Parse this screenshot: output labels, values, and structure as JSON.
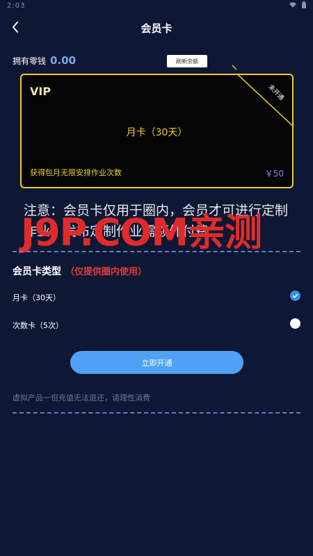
{
  "status_bar": {
    "time": "2:03"
  },
  "header": {
    "title": "会员卡"
  },
  "balance": {
    "label": "拥有零钱",
    "value": "0.00",
    "refresh_label": "刷新余额"
  },
  "card": {
    "vip_label": "VIP",
    "plan_name": "月卡（30天）",
    "description": "获得包月无限安排作业次数",
    "price": "￥50",
    "status_tag": "未开通"
  },
  "notice": {
    "text": "注意：会员卡仅用于圈内，会员才可进行定制作业，发布定制作业需额外付费"
  },
  "watermark": {
    "text": "J9P.COM亲测"
  },
  "card_types": {
    "title": "会员卡类型",
    "note": "（仅提供圈内使用）",
    "options": [
      {
        "label": "月卡（30天）",
        "selected": true
      },
      {
        "label": "次数卡（5次）",
        "selected": false
      }
    ]
  },
  "actions": {
    "open_label": "立即开通"
  },
  "footer": {
    "disclaimer": "虚拟产品一但充值无法退还，请理性消费"
  },
  "colors": {
    "background": "#0e1834",
    "gold": "#f0cd2c",
    "accent_blue": "#4fa1f6",
    "warning_red": "#e0393b",
    "price_purple": "#8c84e0"
  }
}
